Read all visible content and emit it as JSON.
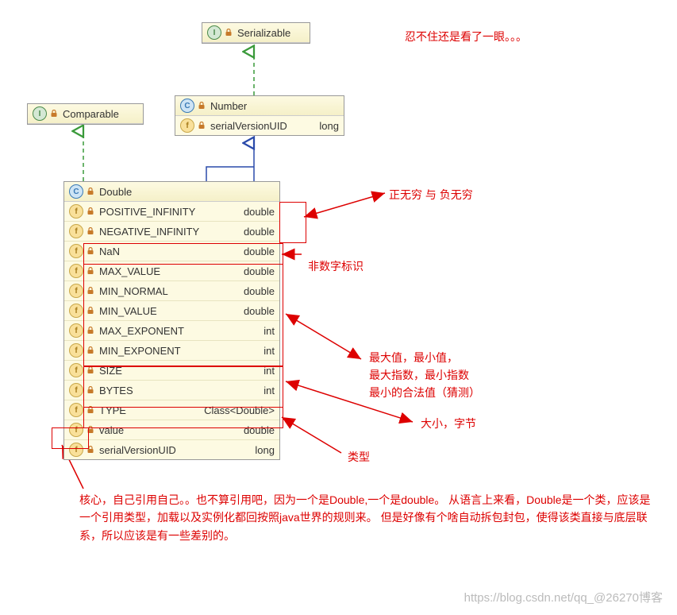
{
  "serializable": {
    "label": "Serializable"
  },
  "comparable": {
    "label": "Comparable"
  },
  "number": {
    "label": "Number",
    "f1": {
      "name": "serialVersionUID",
      "type": "long"
    }
  },
  "double": {
    "label": "Double",
    "fields": [
      {
        "name": "POSITIVE_INFINITY",
        "type": "double"
      },
      {
        "name": "NEGATIVE_INFINITY",
        "type": "double"
      },
      {
        "name": "NaN",
        "type": "double"
      },
      {
        "name": "MAX_VALUE",
        "type": "double"
      },
      {
        "name": "MIN_NORMAL",
        "type": "double"
      },
      {
        "name": "MIN_VALUE",
        "type": "double"
      },
      {
        "name": "MAX_EXPONENT",
        "type": "int"
      },
      {
        "name": "MIN_EXPONENT",
        "type": "int"
      },
      {
        "name": "SIZE",
        "type": "int"
      },
      {
        "name": "BYTES",
        "type": "int"
      },
      {
        "name": "TYPE",
        "type": "Class<Double>"
      },
      {
        "name": "value",
        "type": "double"
      },
      {
        "name": "serialVersionUID",
        "type": "long"
      }
    ]
  },
  "ann": {
    "top": "忍不住还是看了一眼。。。",
    "a1": "正无穷  与    负无穷",
    "a2": "非数字标识",
    "a3a": "最大值，最小值，",
    "a3b": "最大指数，最小指数",
    "a3c": "最小的合法值（猜测）",
    "a4": "大小，字节",
    "a5": "类型",
    "para": "核心，自己引用自己。。也不算引用吧，因为一个是Double,一个是double。  从语言上来看，Double是一个类，应该是一个引用类型，加载以及实例化都回按照java世界的规则来。  但是好像有个啥自动拆包封包，使得该类直接与底层联系，所以应该是有一些差别的。"
  },
  "wm": "https://blog.csdn.net/qq_@26270博客"
}
